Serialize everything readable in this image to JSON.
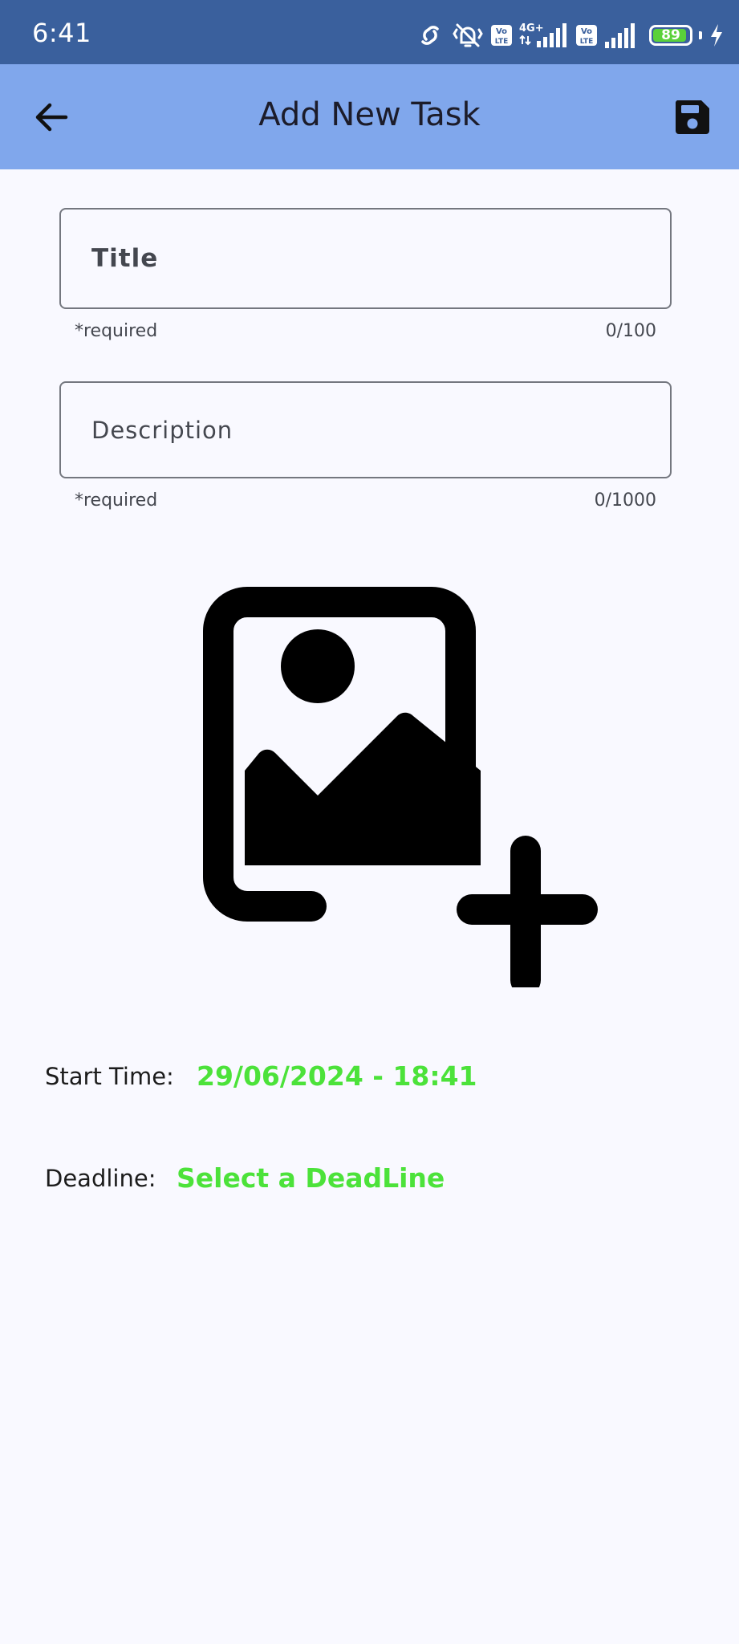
{
  "status_bar": {
    "time": "6:41",
    "icons": [
      "link-icon",
      "vibrate-icon",
      "volte-icon",
      "4g-signal-icon",
      "volte-icon",
      "signal-icon",
      "battery-icon",
      "charging-icon"
    ],
    "network_label": "4G+",
    "volte_label_top": "Vo",
    "volte_label_bottom": "LTE",
    "battery_level": "89",
    "background_color": "#3a609d"
  },
  "app_bar": {
    "title": "Add New Task",
    "back_icon": "arrow-back-icon",
    "save_icon": "save-icon",
    "background_color": "#80a7ec"
  },
  "form": {
    "title_field": {
      "value": "",
      "placeholder": "Title",
      "helper": "*required",
      "counter": "0/100"
    },
    "description_field": {
      "value": "",
      "placeholder": "Description",
      "helper": "*required",
      "counter": "0/1000"
    },
    "image_picker_icon": "add-photo-icon",
    "start_time": {
      "label": "Start Time:",
      "value": "29/06/2024 - 18:41"
    },
    "deadline": {
      "label": "Deadline:",
      "value": "Select a DeadLine"
    },
    "accent_color": "#4ce23a"
  }
}
